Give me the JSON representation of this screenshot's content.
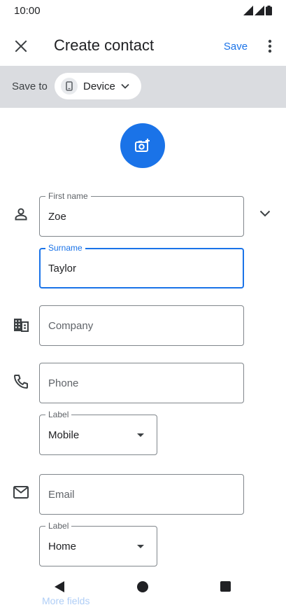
{
  "status_bar": {
    "time": "10:00"
  },
  "app_bar": {
    "title": "Create contact",
    "save_label": "Save"
  },
  "save_to": {
    "label": "Save to",
    "account": "Device"
  },
  "form": {
    "first_name": {
      "label": "First name",
      "value": "Zoe"
    },
    "surname": {
      "label": "Surname",
      "value": "Taylor"
    },
    "company": {
      "placeholder": "Company"
    },
    "phone": {
      "placeholder": "Phone"
    },
    "phone_label": {
      "label": "Label",
      "value": "Mobile"
    },
    "email": {
      "placeholder": "Email"
    },
    "email_label": {
      "label": "Label",
      "value": "Home"
    }
  },
  "more_fields_label": "More fields",
  "icons": {
    "close": "close-icon",
    "more": "more-vert-icon",
    "device": "smartphone-icon",
    "chip_chevron": "chevron-down-icon",
    "photo": "add-photo-icon",
    "person": "person-icon",
    "expand": "chevron-down-icon",
    "company": "business-icon",
    "phone": "phone-icon",
    "email": "mail-icon"
  },
  "colors": {
    "accent": "#1a73e8",
    "save_to_bar": "#dadce0",
    "outline": "#80868b"
  }
}
